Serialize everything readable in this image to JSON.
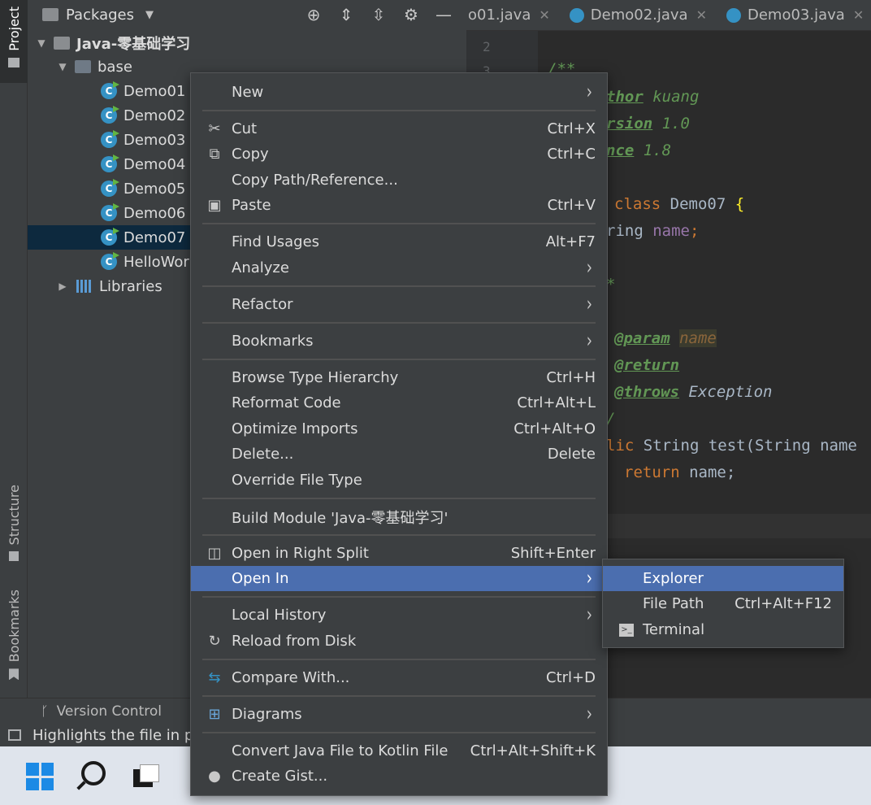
{
  "stripe": {
    "project_label": "Project",
    "structure_label": "Structure",
    "bookmarks_label": "Bookmarks"
  },
  "panel": {
    "title": "Packages",
    "project_name": "Java-零基础学习",
    "package_name": "base",
    "classes": [
      "Demo01",
      "Demo02",
      "Demo03",
      "Demo04",
      "Demo05",
      "Demo06",
      "Demo07",
      "HelloWor"
    ],
    "selected_class": "Demo07",
    "libraries_label": "Libraries"
  },
  "editor": {
    "tabs": [
      {
        "label": "o01.java"
      },
      {
        "label": "Demo02.java"
      },
      {
        "label": "Demo03.java"
      }
    ],
    "line_numbers": [
      "2",
      "3"
    ]
  },
  "code": {
    "doc_open": "/**",
    "author_tag": "thor",
    "author_val": " kuang",
    "version_tag": "rsion",
    "version_val": " 1.0",
    "since_tag": "nce",
    "since_val": " 1.8",
    "class_kw": "class",
    "class_name": " Demo07 ",
    "brace": "{",
    "field_type": "ring",
    "field_name": " name",
    "semi": ";",
    "star": "*",
    "param_tag": "@param",
    "param_name": "name",
    "return_tag": "@return",
    "throws_tag": "@throws",
    "throws_val": " Exception",
    "doc_close": "/",
    "method_kw": "lic",
    "method_sig": " String test(String name",
    "return_kw": "return",
    "return_val": " name;"
  },
  "bottom": {
    "version_control": "Version Control",
    "status_text": "Highlights the file in p"
  },
  "menu": {
    "items": [
      {
        "label": "New",
        "shortcut": "",
        "submenu": "›"
      },
      {
        "label": "Cut",
        "shortcut": "Ctrl+X",
        "icon": "✂"
      },
      {
        "label": "Copy",
        "shortcut": "Ctrl+C",
        "icon": "⧉"
      },
      {
        "label": "Copy Path/Reference...",
        "shortcut": ""
      },
      {
        "label": "Paste",
        "shortcut": "Ctrl+V",
        "icon": "▣"
      },
      {
        "label": "Find Usages",
        "shortcut": "Alt+F7"
      },
      {
        "label": "Analyze",
        "shortcut": "",
        "submenu": "›"
      },
      {
        "label": "Refactor",
        "shortcut": "",
        "submenu": "›"
      },
      {
        "label": "Bookmarks",
        "shortcut": "",
        "submenu": "›"
      },
      {
        "label": "Browse Type Hierarchy",
        "shortcut": "Ctrl+H"
      },
      {
        "label": "Reformat Code",
        "shortcut": "Ctrl+Alt+L"
      },
      {
        "label": "Optimize Imports",
        "shortcut": "Ctrl+Alt+O"
      },
      {
        "label": "Delete...",
        "shortcut": "Delete"
      },
      {
        "label": "Override File Type",
        "shortcut": ""
      },
      {
        "label": "Build Module 'Java-零基础学习'",
        "shortcut": ""
      },
      {
        "label": "Open in Right Split",
        "shortcut": "Shift+Enter",
        "icon": "◫"
      },
      {
        "label": "Open In",
        "shortcut": "",
        "submenu": "›"
      },
      {
        "label": "Local History",
        "shortcut": "",
        "submenu": "›"
      },
      {
        "label": "Reload from Disk",
        "shortcut": "",
        "icon": "↻"
      },
      {
        "label": "Compare With...",
        "shortcut": "Ctrl+D",
        "icon": "⇆"
      },
      {
        "label": "Diagrams",
        "shortcut": "",
        "submenu": "›",
        "icon": "⊞"
      },
      {
        "label": "Convert Java File to Kotlin File",
        "shortcut": "Ctrl+Alt+Shift+K"
      },
      {
        "label": "Create Gist...",
        "shortcut": "",
        "icon": "●"
      }
    ]
  },
  "submenu": {
    "items": [
      {
        "label": "Explorer",
        "shortcut": ""
      },
      {
        "label": "File Path",
        "shortcut": "Ctrl+Alt+F12"
      },
      {
        "label": "Terminal",
        "shortcut": "",
        "icon": ">_"
      }
    ]
  },
  "colors": {
    "menu_highlight": "#4b6eaf",
    "selection": "#0d293e",
    "class_icon": "#3592c4"
  }
}
